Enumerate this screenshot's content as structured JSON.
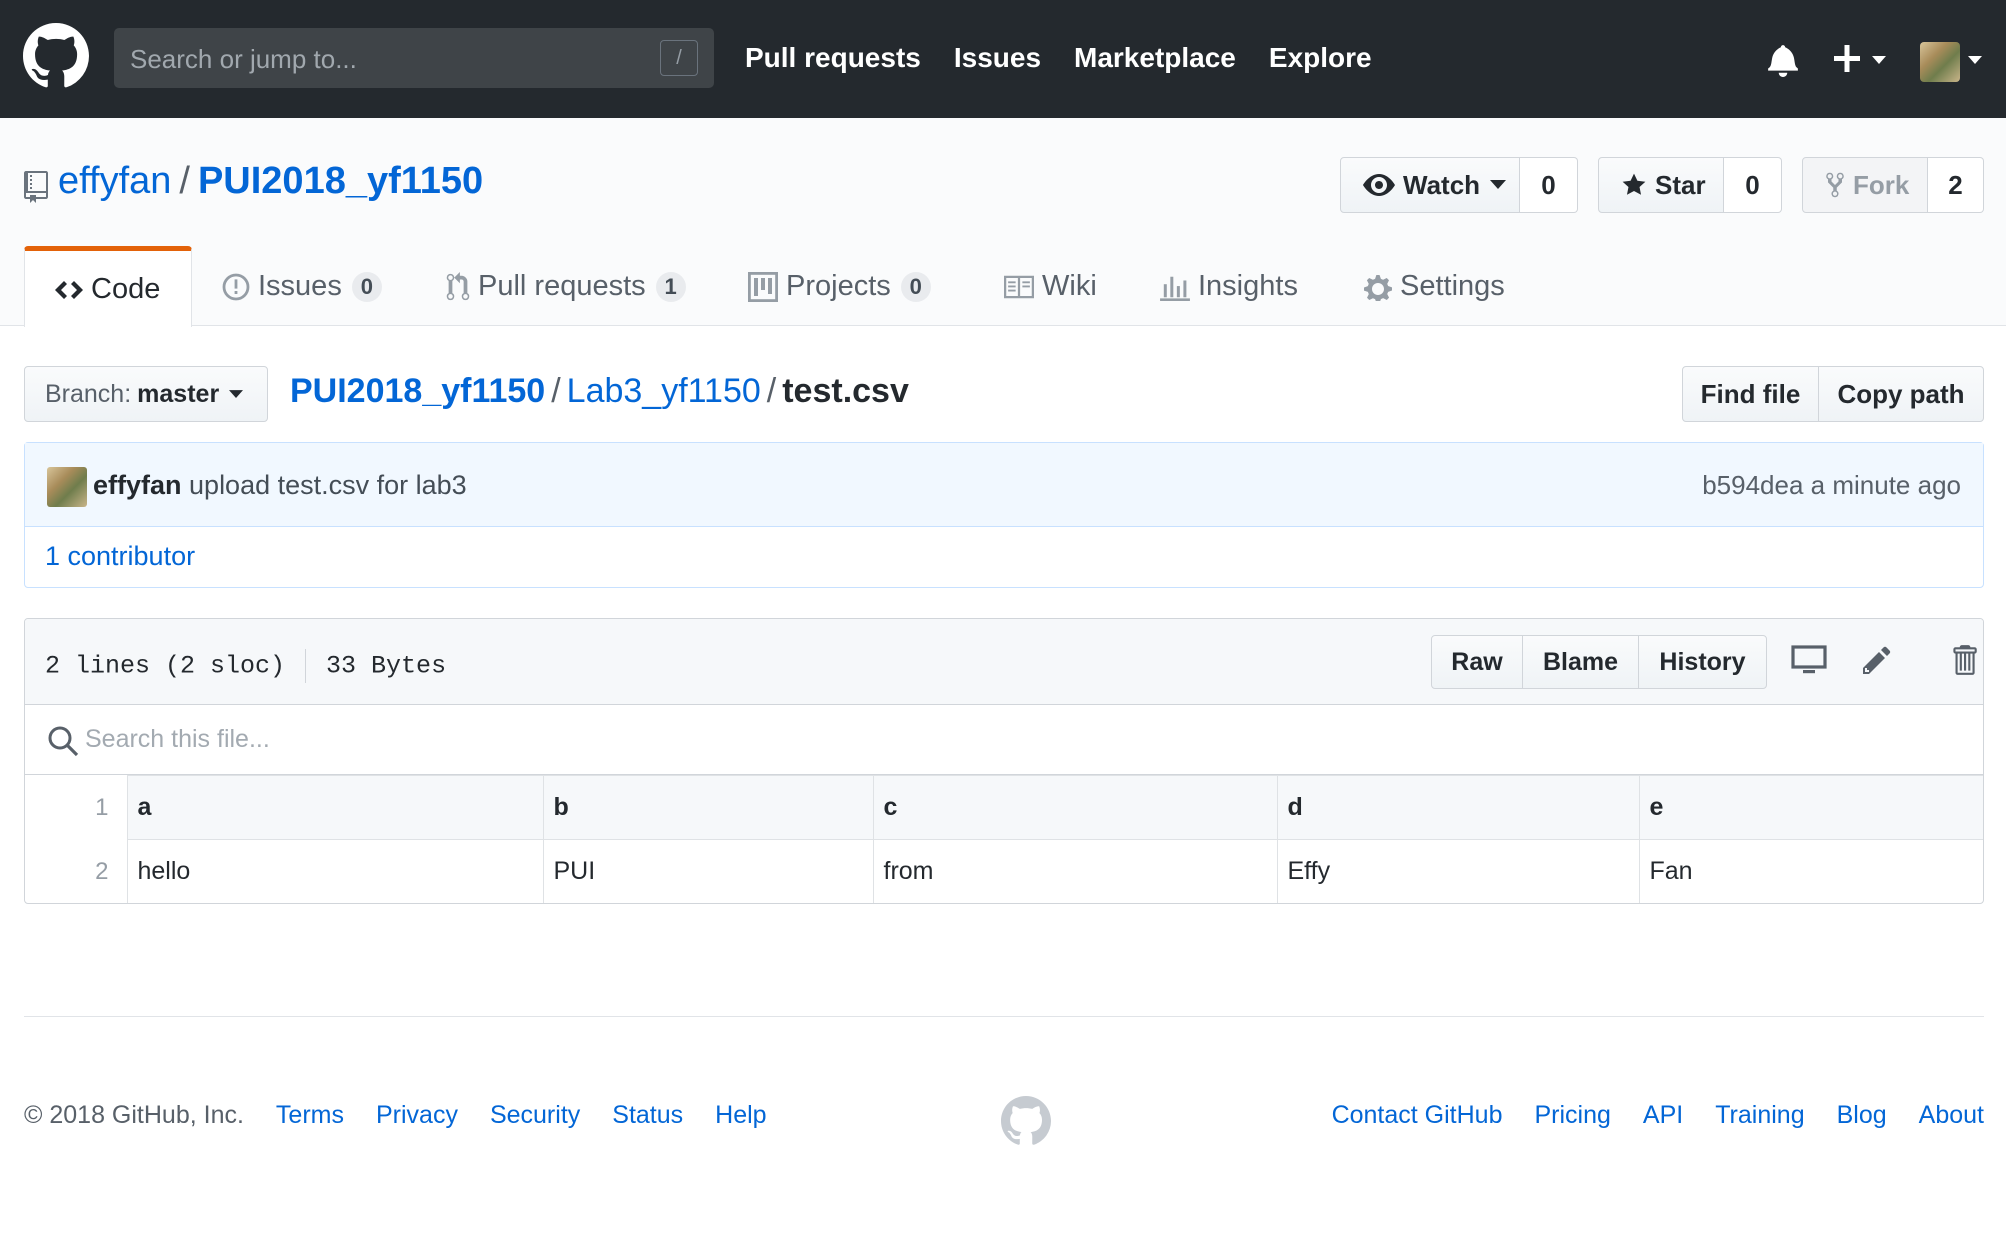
{
  "header": {
    "search_placeholder": "Search or jump to...",
    "search_key": "/",
    "nav": [
      "Pull requests",
      "Issues",
      "Marketplace",
      "Explore"
    ]
  },
  "repo": {
    "owner": "effyfan",
    "separator": "/",
    "name": "PUI2018_yf1150",
    "watch_label": "Watch",
    "watch_count": "0",
    "star_label": "Star",
    "star_count": "0",
    "fork_label": "Fork",
    "fork_count": "2"
  },
  "tabs": [
    {
      "label": "Code"
    },
    {
      "label": "Issues",
      "counter": "0"
    },
    {
      "label": "Pull requests",
      "counter": "1"
    },
    {
      "label": "Projects",
      "counter": "0"
    },
    {
      "label": "Wiki"
    },
    {
      "label": "Insights"
    },
    {
      "label": "Settings"
    }
  ],
  "path": {
    "branch_prefix": "Branch:",
    "branch": "master",
    "crumbs": [
      "PUI2018_yf1150",
      "Lab3_yf1150"
    ],
    "file": "test.csv",
    "find_file": "Find file",
    "copy_path": "Copy path"
  },
  "commit": {
    "author": "effyfan",
    "message": "upload test.csv for lab3",
    "sha": "b594dea",
    "time": "a minute ago",
    "contributors": "1 contributor"
  },
  "file": {
    "lines": "2 lines (2 sloc)",
    "size": "33 Bytes",
    "raw": "Raw",
    "blame": "Blame",
    "history": "History",
    "search_placeholder": "Search this file...",
    "header_row": {
      "num": "1",
      "cells": [
        "a",
        "b",
        "c",
        "d",
        "e"
      ]
    },
    "data_row": {
      "num": "2",
      "cells": [
        "hello",
        "PUI",
        "from",
        "Effy",
        "Fan"
      ]
    }
  },
  "footer": {
    "copyright": "© 2018 GitHub, Inc.",
    "left_links": [
      "Terms",
      "Privacy",
      "Security",
      "Status",
      "Help"
    ],
    "right_links": [
      "Contact GitHub",
      "Pricing",
      "API",
      "Training",
      "Blog",
      "About"
    ]
  },
  "colors": {
    "header_bg": "#24292e",
    "link": "#0366d6",
    "tab_accent": "#e36209",
    "commit_bg": "#f1f8ff"
  }
}
